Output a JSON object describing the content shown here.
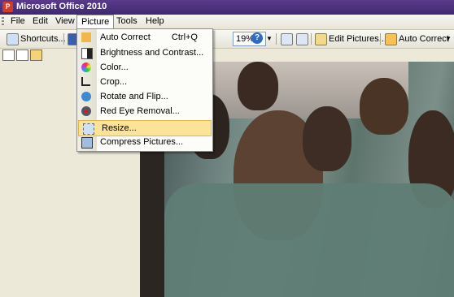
{
  "window": {
    "title": "Microsoft Office 2010",
    "app_icon_glyph": "P"
  },
  "menubar": {
    "items": [
      {
        "label": "File"
      },
      {
        "label": "Edit"
      },
      {
        "label": "View"
      },
      {
        "label": "Picture"
      },
      {
        "label": "Tools"
      },
      {
        "label": "Help"
      }
    ]
  },
  "toolbar": {
    "shortcuts_label": "Shortcuts...",
    "zoom_value": "19%",
    "edit_pictures_label": "Edit Pictures...",
    "auto_correct_label": "Auto Correct"
  },
  "picture_menu": {
    "items": [
      {
        "label": "Auto Correct",
        "shortcut": "Ctrl+Q",
        "icon": "auto-correct-icon"
      },
      {
        "label": "Brightness and Contrast...",
        "icon": "brightness-contrast-icon"
      },
      {
        "label": "Color...",
        "icon": "color-wheel-icon"
      },
      {
        "label": "Crop...",
        "icon": "crop-icon"
      },
      {
        "label": "Rotate and Flip...",
        "icon": "rotate-flip-icon"
      },
      {
        "label": "Red Eye Removal...",
        "icon": "red-eye-icon"
      },
      {
        "label": "Resize...",
        "icon": "resize-icon",
        "highlighted": true
      },
      {
        "label": "Compress Pictures...",
        "icon": "compress-icon"
      }
    ]
  },
  "colors": {
    "title_bar": "#4a2f7a",
    "highlight": "#fbe39a",
    "jacket": "#5f7d75"
  }
}
